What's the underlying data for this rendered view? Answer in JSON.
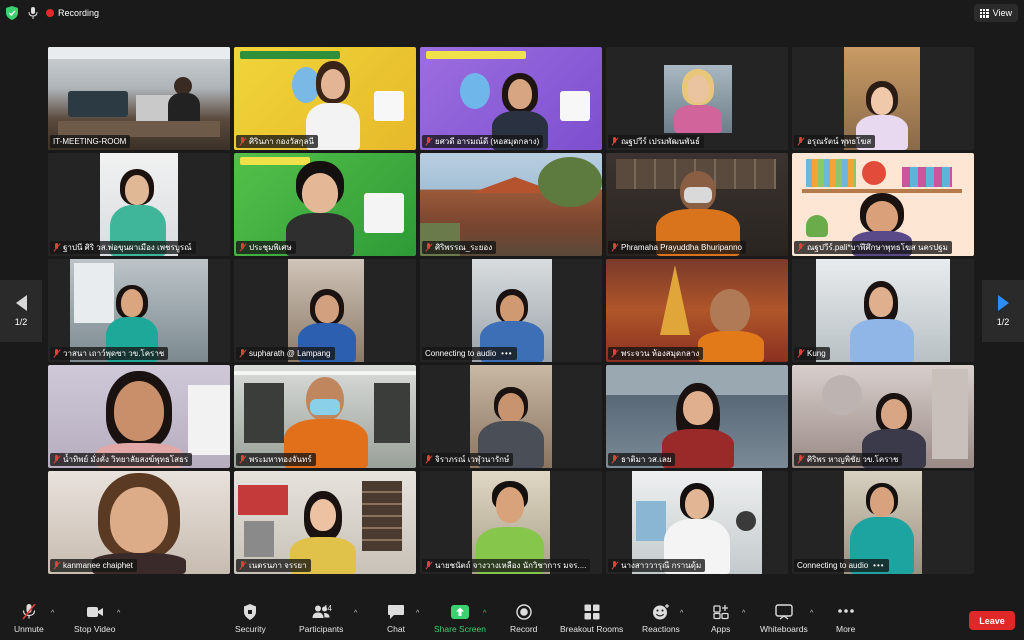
{
  "topbar": {
    "recording": "Recording",
    "view_label": "View"
  },
  "pager": {
    "left": "1/2",
    "right": "1/2"
  },
  "tiles": [
    {
      "name": "IT-MEETING-ROOM",
      "muted": false
    },
    {
      "name": "ศิรินภา กองวัสกุลนี",
      "muted": true
    },
    {
      "name": "ยศวดี อารมณ์ดี (หอสมุดกลาง)",
      "muted": true
    },
    {
      "name": "ณฐปวีร์ เปรมพัฒนพันธ์",
      "muted": true
    },
    {
      "name": "อรุณรัตน์ พุทธโฆส",
      "muted": true
    },
    {
      "name": "ฐาปนี ศิริ วส.พ่อขุนผาเมือง เพชรบูรณ์",
      "muted": true
    },
    {
      "name": "ประชุมพิเศษ",
      "muted": true
    },
    {
      "name": "ศิริพรรณ_ระยอง",
      "muted": true
    },
    {
      "name": "Phramaha Prayuddha Bhuripanno",
      "muted": true
    },
    {
      "name": "ณฐปวีร์.pali*บาฬีศึกษาพุทธโฆส นครปฐม",
      "muted": true
    },
    {
      "name": "วาสนา เถาว์พุดซา วข.โคราช",
      "muted": true
    },
    {
      "name": "supharath @ Lampang",
      "muted": true
    },
    {
      "name": "Connecting to audio",
      "muted": false,
      "connecting": true
    },
    {
      "name": "พระจวน ห้องสมุดกลาง",
      "muted": true
    },
    {
      "name": "Kung",
      "muted": true
    },
    {
      "name": "น้ำทิพย์ มั่งคั่ง วิทยาลัยสงฆ์พุทธโสธร",
      "muted": true
    },
    {
      "name": "พระมหาทองจันทร์",
      "muted": true
    },
    {
      "name": "จิราภรณ์ เวฬุวนารักษ์",
      "muted": true
    },
    {
      "name": "ธาติมา วส.เลย",
      "muted": true
    },
    {
      "name": "ศิริพร หาญพิชัย วข.โคราช",
      "muted": true
    },
    {
      "name": "kanmanee chaiphet",
      "muted": true
    },
    {
      "name": "เนตรนภา จรรยา",
      "muted": true
    },
    {
      "name": "นายชนัตถ์ จางวางเหลือง นักวิชาการ มจร....",
      "muted": true
    },
    {
      "name": "นางสาววารุณี กรานดุ้ม",
      "muted": true
    },
    {
      "name": "Connecting to audio",
      "muted": false,
      "connecting": true
    }
  ],
  "toolbar": {
    "unmute": "Unmute",
    "stop_video": "Stop Video",
    "security": "Security",
    "participants": "Participants",
    "participant_count": "44",
    "chat": "Chat",
    "share_screen": "Share Screen",
    "record": "Record",
    "breakout_rooms": "Breakout Rooms",
    "reactions": "Reactions",
    "apps": "Apps",
    "whiteboards": "Whiteboards",
    "more": "More",
    "leave": "Leave"
  },
  "colors": {
    "active_speaker": "#3bd16f",
    "leave": "#e02828",
    "share": "#3bd16f",
    "record_dot": "#e22a2a"
  }
}
